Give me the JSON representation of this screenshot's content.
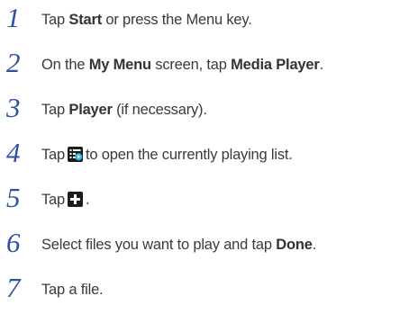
{
  "steps": [
    {
      "num": "1",
      "parts": [
        "Tap ",
        "Start",
        " or press the Menu key."
      ]
    },
    {
      "num": "2",
      "parts": [
        "On the ",
        "My Menu",
        " screen, tap ",
        "Media Player",
        "."
      ]
    },
    {
      "num": "3",
      "parts": [
        "Tap ",
        "Player",
        " (if necessary)."
      ]
    },
    {
      "num": "4",
      "parts": [
        "Tap",
        "to open the currently playing list."
      ],
      "icon": "now-playing-list-icon"
    },
    {
      "num": "5",
      "parts": [
        "Tap",
        "."
      ],
      "icon": "add-plus-icon"
    },
    {
      "num": "6",
      "parts": [
        "Select files you want to play and tap ",
        "Done",
        "."
      ]
    },
    {
      "num": "7",
      "parts": [
        "Tap a file."
      ]
    }
  ],
  "colors": {
    "number": "#2c52a0",
    "text": "#3a3a3a",
    "icon_background": "#1c1c1c",
    "icon_accent": "#35b7e8"
  }
}
